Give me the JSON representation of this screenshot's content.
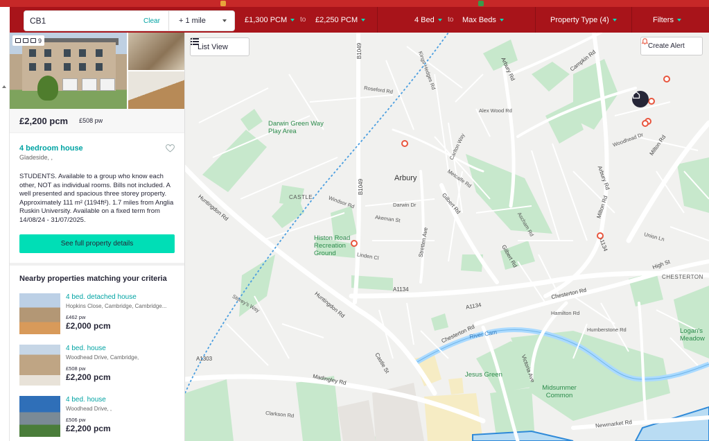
{
  "search": {
    "value": "CB1",
    "clear_label": "Clear",
    "radius": "+ 1 mile"
  },
  "filters": {
    "min_price": "£1,300 PCM",
    "to1": "to",
    "max_price": "£2,250 PCM",
    "min_beds": "4 Bed",
    "to2": "to",
    "max_beds": "Max Beds",
    "property_type": "Property Type (4)",
    "more_filters": "Filters"
  },
  "listing": {
    "photo_count": "9",
    "price": "£2,200 pcm",
    "price_pw": "£508 pw",
    "title": "4 bedroom house",
    "address": "Gladeside, ,",
    "description": "STUDENTS. Available to a group who know each other, NOT as individual rooms. Bills not included. A well presented and spacious three storey property. Approximately 111 m² (1194ft²). 1.7 miles from Anglia Ruskin University. Available on a fixed term from 14/08/24 - 31/07/2025.",
    "details_button": "See full property details"
  },
  "nearby": {
    "heading": "Nearby properties matching your criteria",
    "items": [
      {
        "title": "4 bed. detached house",
        "address": "Hopkins Close, Cambridge, Cambridge...",
        "pw": "£462 pw",
        "price": "£2,000 pcm"
      },
      {
        "title": "4 bed. house",
        "address": "Woodhead Drive, Cambridge,",
        "pw": "£508 pw",
        "price": "£2,200 pcm"
      },
      {
        "title": "4 bed. house",
        "address": "Woodhead Drive, ,",
        "pw": "£506 pw",
        "price": "£2,200 pcm"
      }
    ]
  },
  "map": {
    "list_view": "List View",
    "create_alert": "Create Alert",
    "labels": {
      "arbury": "Arbury",
      "darwin_green": "Darwin Green Way Play Area",
      "histon_road": "Histon Road Recreation Ground",
      "jesus_green": "Jesus Green",
      "midsummer": "Midsummer Common",
      "logans": "Logan's Meadow",
      "castle": "CASTLE",
      "chesterton": "CHESTERTON",
      "river_cam": "River Cam",
      "a1134_a": "A1134",
      "a1134_b": "A1134",
      "a1134_c": "A1134",
      "a1303": "A1303",
      "b1049_a": "B1049",
      "b1049_b": "B1049",
      "huntingdon_a": "Huntingdon Rd",
      "huntingdon_b": "Huntingdon Rd",
      "madingley": "Madingley Rd",
      "gilbert": "Gilbert Rd",
      "gilbert_b": "Gilbert Rd",
      "milton_a": "Milton Rd",
      "milton_b": "Milton Rd",
      "chesterton_rd": "Chesterton Rd",
      "chesterton_rd_b": "Chesterton Rd",
      "arbury_rd": "Arbury Rd",
      "arbury_rd_b": "Arbury Rd",
      "campkin": "Campkin Rd",
      "stretten": "Stretten Ave",
      "high_st": "High St",
      "newmarket": "Newmarket Rd",
      "victoria": "Victoria Ave",
      "castle_st": "Castle St",
      "windsor": "Windsor Rd",
      "darwin_dr": "Darwin Dr",
      "akeman": "Akeman St",
      "linden": "Linden Cl",
      "alex_wood": "Alex Wood Rd",
      "roseford": "Roseford Rd",
      "carlton": "Carlton Way",
      "union": "Union Ln",
      "hamilton": "Hamilton Rd",
      "humberstone": "Humberstone Rd",
      "clarkson": "Clarkson Rd",
      "storeys": "Storey's Way",
      "woodhead": "Woodhead Dr",
      "kings_hedges": "Kings Hedges Rd",
      "ascham": "Ascham Rd",
      "metcalfe": "Metcalfe Rd"
    }
  }
}
